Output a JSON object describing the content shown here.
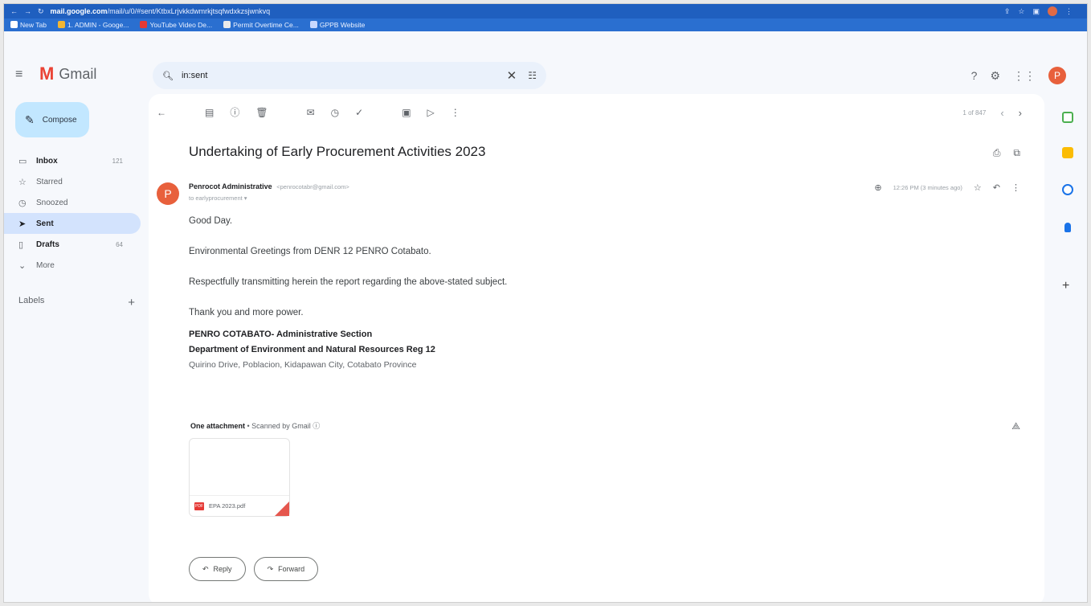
{
  "browser": {
    "url_host": "mail.google.com",
    "url_rest": "/mail/u/0/#sent/KtbxLrjvkkdwmrkjtsqfwdxkzsjwnkvq",
    "bookmarks": [
      "New Tab",
      "1. ADMIN - Googe...",
      "YouTube Video De...",
      "Permit Overtime Ce...",
      "GPPB Website"
    ]
  },
  "app": {
    "name": "Gmail",
    "search_query": "in:sent",
    "profile_initial": "P"
  },
  "sidebar": {
    "compose_label": "Compose",
    "items": [
      {
        "label": "Inbox",
        "count": "121"
      },
      {
        "label": "Starred",
        "count": ""
      },
      {
        "label": "Snoozed",
        "count": ""
      },
      {
        "label": "Sent",
        "count": ""
      },
      {
        "label": "Drafts",
        "count": "64"
      },
      {
        "label": "More",
        "count": ""
      }
    ],
    "labels_title": "Labels"
  },
  "toolbar": {
    "pager_text": "1 of 847"
  },
  "email": {
    "subject": "Undertaking of Early Procurement Activities 2023",
    "sender_initial": "P",
    "sender_name": "Penrocot Administrative",
    "sender_address": "<penrocotabr@gmail.com>",
    "to_line": "to earlyprocurement ▾",
    "time": "12:26 PM (3 minutes ago)",
    "greeting": "Good Day.",
    "line1": "Environmental Greetings from DENR 12 PENRO Cotabato.",
    "line2": "Respectfully transmitting herein the report regarding the above-stated subject.",
    "line3": "Thank you and more power.",
    "sig_line1": "PENRO COTABATO- Administrative Section",
    "sig_line2": "Department of Environment and Natural Resources Reg 12",
    "sig_line3": "Quirino Drive, Poblacion, Kidapawan City, Cotabato Province"
  },
  "attachments": {
    "header_bold": "One attachment",
    "header_rest": "• Scanned by Gmail ⓘ",
    "file_name": "EPA 2023.pdf",
    "file_badge": "PDF"
  },
  "actions": {
    "reply_label": "Reply",
    "forward_label": "Forward"
  },
  "colors": {
    "accent": "#c2e7ff",
    "active_nav": "#d3e3fd",
    "avatar": "#e8603c"
  }
}
